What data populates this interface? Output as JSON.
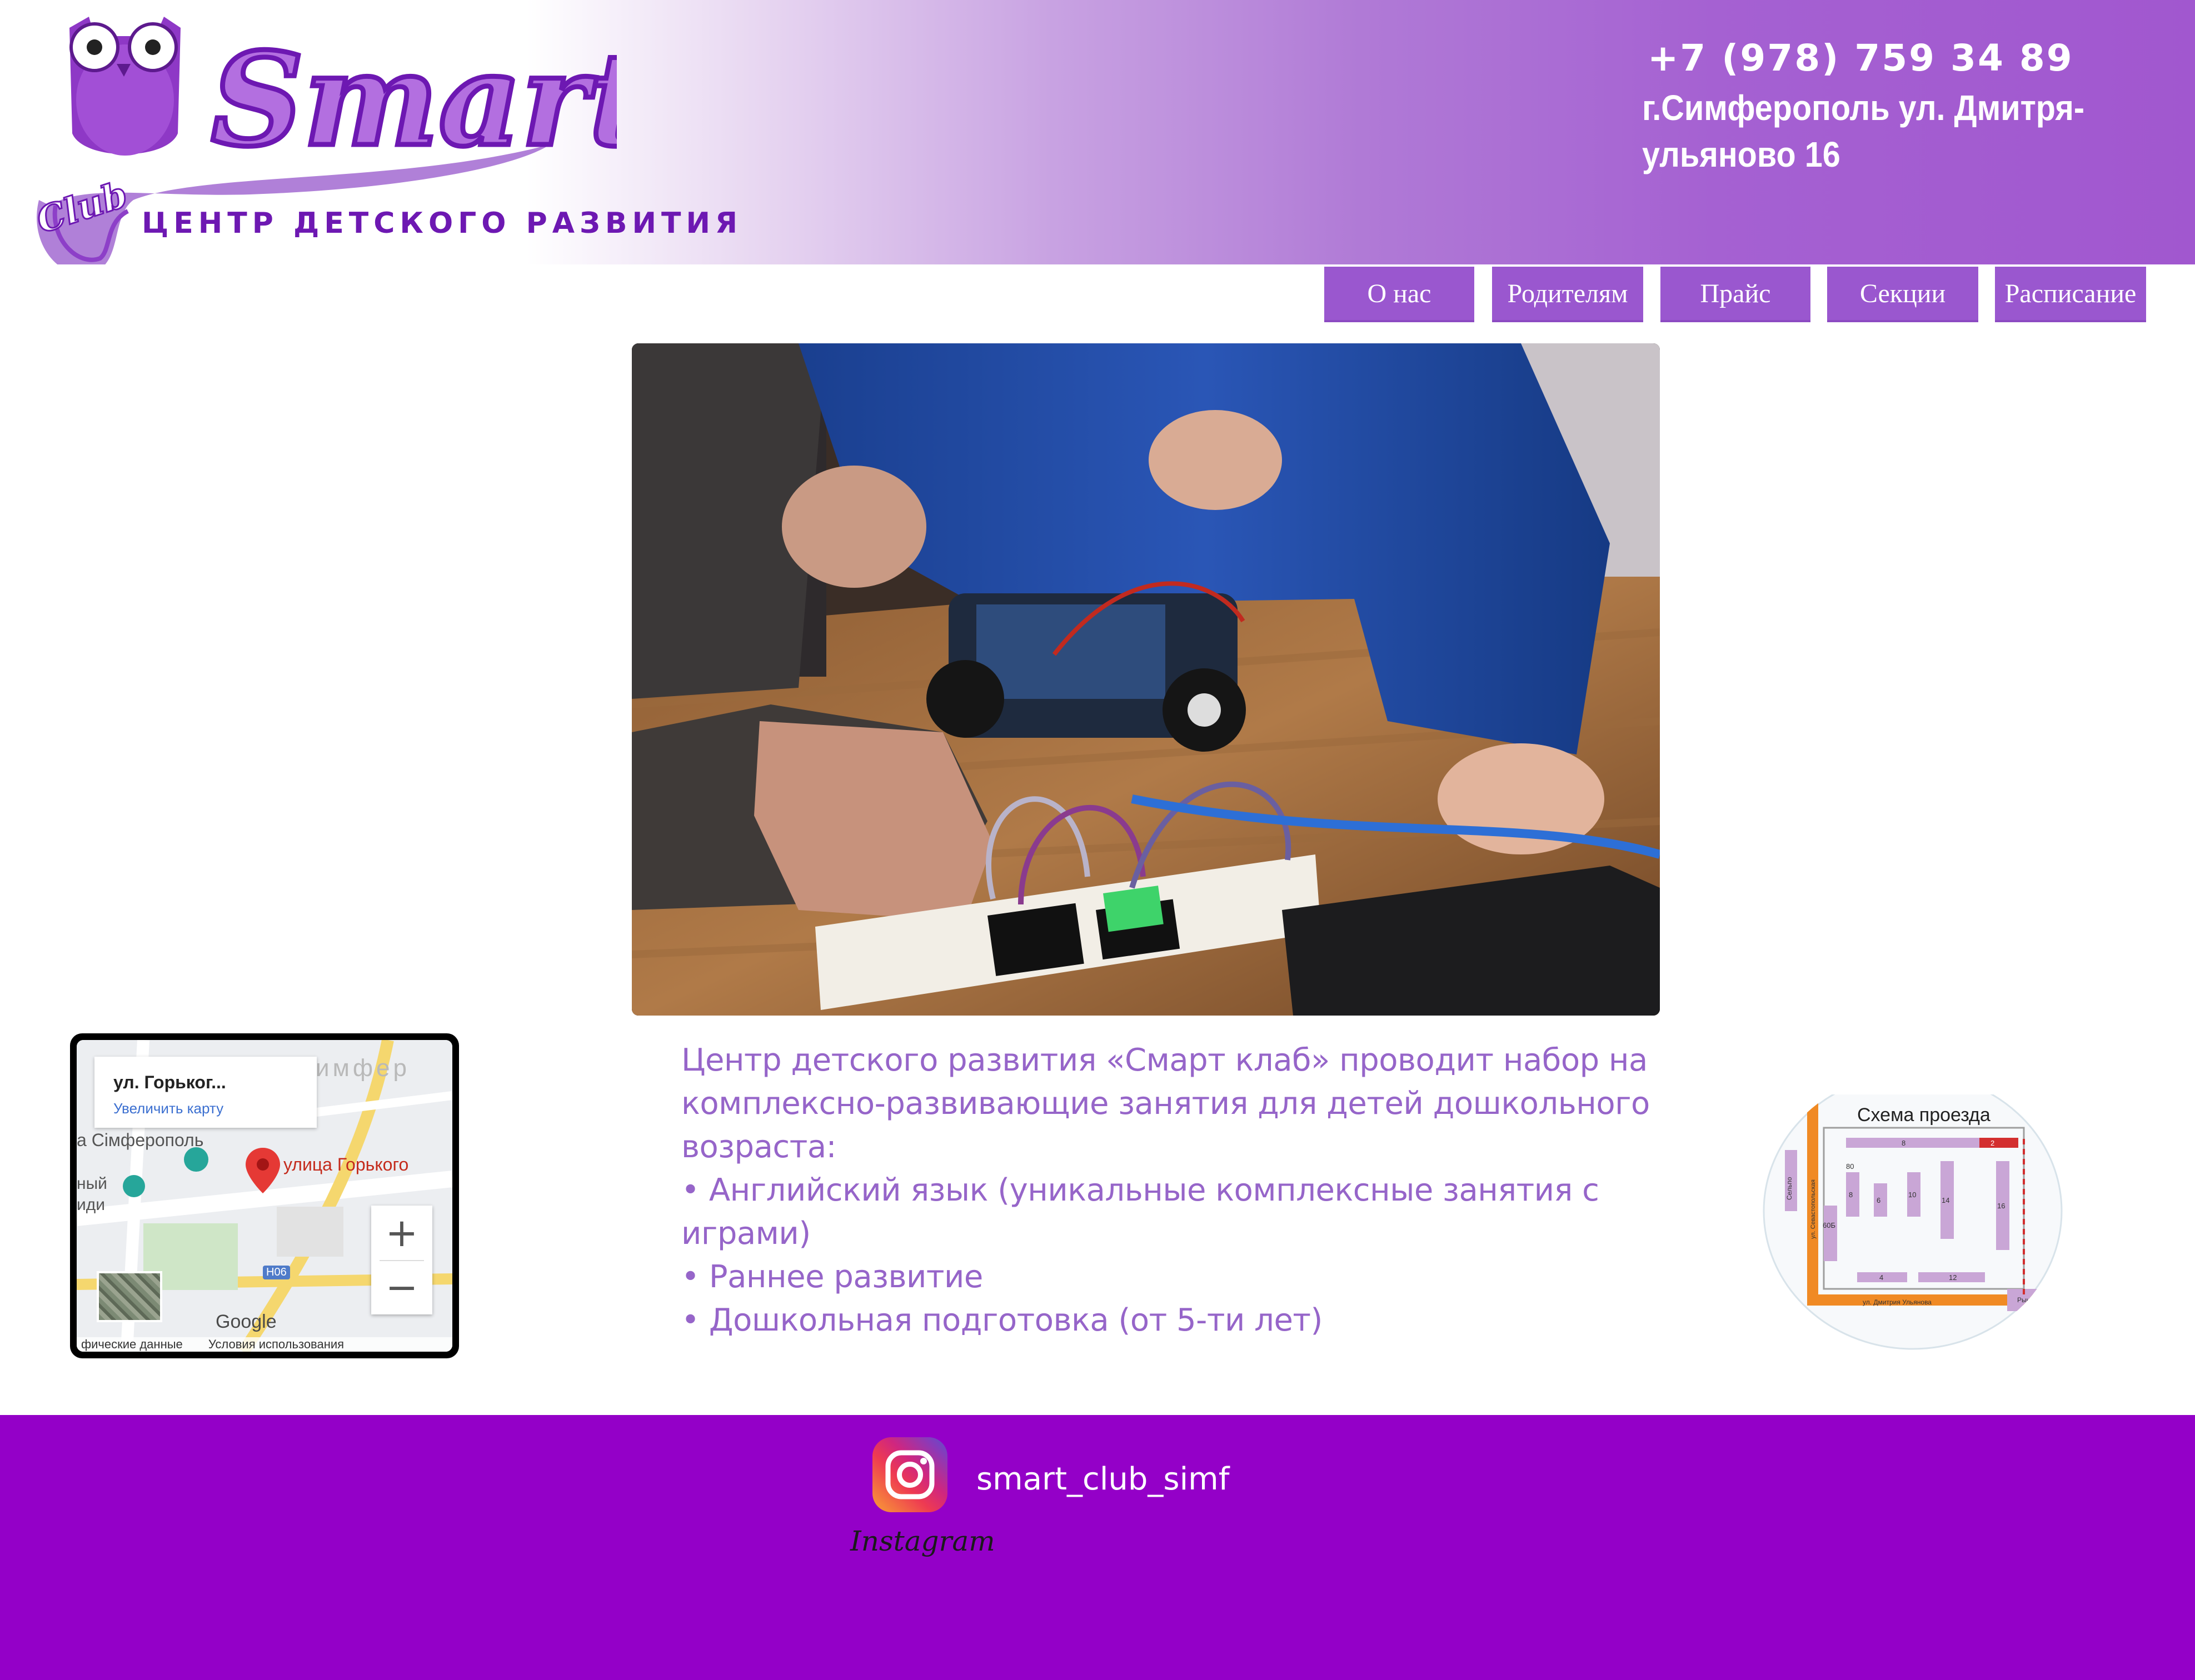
{
  "header": {
    "logo": {
      "brand": "Smart",
      "club": "Club",
      "tagline": "ЦЕНТР ДЕТСКОГО РАЗВИТИЯ"
    },
    "phone": "+7 (978) 759 34 89",
    "address": "г.Симферополь ул. Дмитря-ульяново 16"
  },
  "nav": {
    "items": [
      {
        "label": "О нас"
      },
      {
        "label": "Родителям"
      },
      {
        "label": "Прайс"
      },
      {
        "label": "Секции"
      },
      {
        "label": "Расписание"
      }
    ]
  },
  "map": {
    "place_title": "ул. Горьког...",
    "enlarge_link": "Увеличить карту",
    "street_label": "улица Горького",
    "city_label": "а Сiмферополь",
    "road_badge": "Н06",
    "zoom_in": "+",
    "zoom_out": "−",
    "footer_data": "фические данные",
    "footer_terms": "Условия использования"
  },
  "intro": {
    "paragraph": "Центр детского развития «Смарт клаб» проводит набор на комплексно-развивающие занятия для детей дошкольного возраста:",
    "bullets": [
      "• Английский язык (уникальные комплексные занятия с играми)",
      "• Раннее развитие",
      "• Дошкольная подготовка (от 5-ти лет)"
    ]
  },
  "scheme": {
    "title": "Схема проезда",
    "street_bottom": "ул. Дмитрия Ульянова",
    "street_left": "Сельпо",
    "street_vertical": "ул. Севастопольская",
    "market": "Рынок",
    "buildings": [
      "8",
      "8",
      "6",
      "10",
      "14",
      "16",
      "80",
      "60Б",
      "4",
      "12",
      "2"
    ]
  },
  "footer": {
    "instagram_label": "Instagram",
    "handle": "smart_club_simf"
  },
  "colors": {
    "accent": "#9a57cf",
    "text_purple": "#9665c9",
    "footer_bg": "#9400c8",
    "logo_purple": "#6d18b2"
  }
}
